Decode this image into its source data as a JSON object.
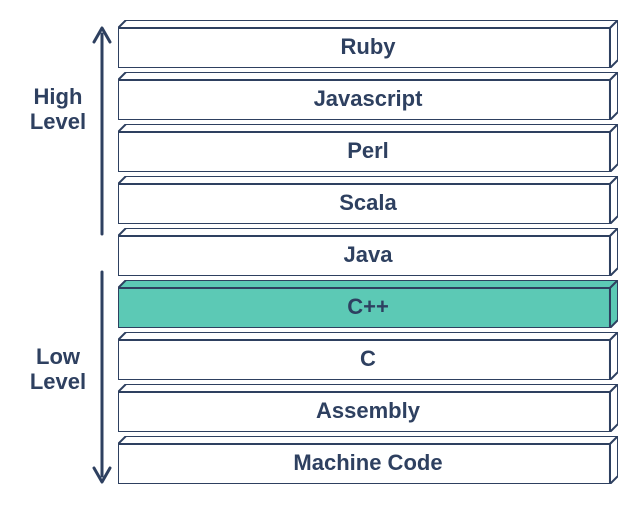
{
  "labels": {
    "high": "High",
    "low": "Low",
    "level": "Level"
  },
  "colors": {
    "stroke": "#2e4060",
    "fill_default": "#ffffff",
    "fill_highlight": "#5cc9b5"
  },
  "layers": [
    {
      "name": "Ruby",
      "highlight": false
    },
    {
      "name": "Javascript",
      "highlight": false
    },
    {
      "name": "Perl",
      "highlight": false
    },
    {
      "name": "Scala",
      "highlight": false
    },
    {
      "name": "Java",
      "highlight": false
    },
    {
      "name": "C++",
      "highlight": true
    },
    {
      "name": "C",
      "highlight": false
    },
    {
      "name": "Assembly",
      "highlight": false
    },
    {
      "name": "Machine Code",
      "highlight": false
    }
  ]
}
